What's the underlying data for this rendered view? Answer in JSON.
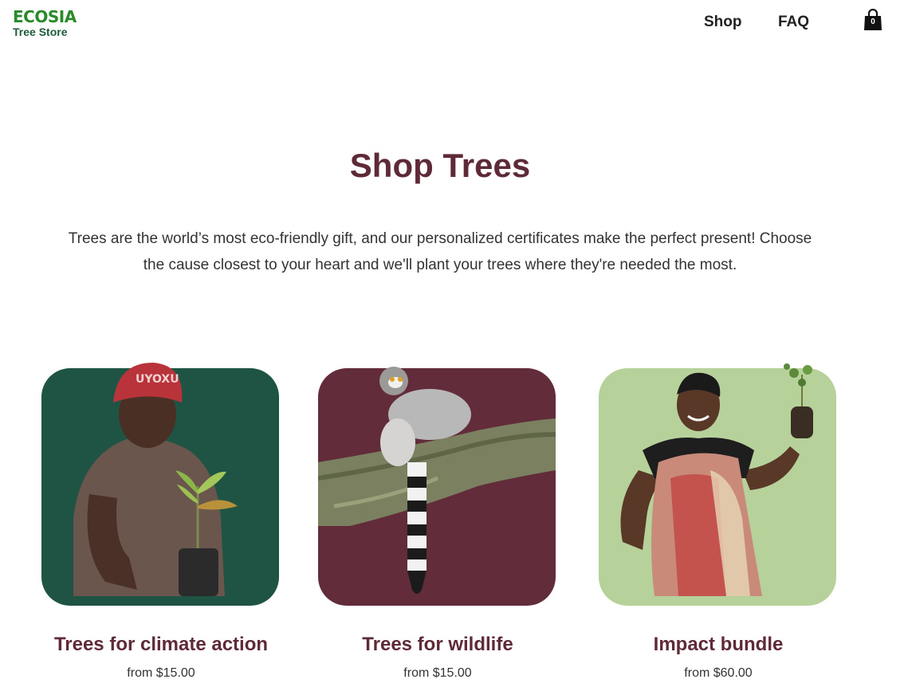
{
  "header": {
    "logo_main": "ECOSIA",
    "logo_sub": "Tree Store",
    "nav": [
      {
        "label": "Shop"
      },
      {
        "label": "FAQ"
      }
    ],
    "cart_count": "0"
  },
  "main": {
    "title": "Shop Trees",
    "intro": "Trees are the world’s most eco-friendly gift, and our personalized certificates make the perfect present! Choose the cause closest to your heart and we'll plant your trees where they're needed the most."
  },
  "products": [
    {
      "title": "Trees for climate action",
      "price": "from $15.00",
      "bg": "#1f5444"
    },
    {
      "title": "Trees for wildlife",
      "price": "from $15.00",
      "bg": "#632c3a"
    },
    {
      "title": "Impact bundle",
      "price": "from $60.00",
      "bg": "#b7d19b"
    }
  ],
  "colors": {
    "brand_green": "#2a8a2a",
    "heading": "#5f2a38"
  }
}
